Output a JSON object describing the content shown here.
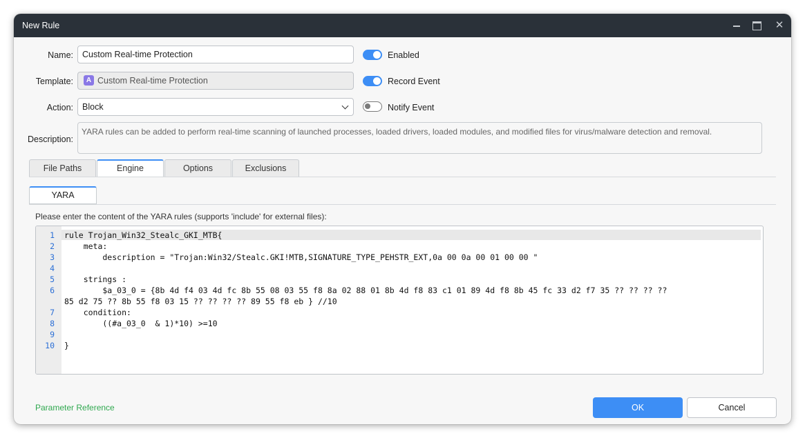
{
  "window": {
    "title": "New Rule"
  },
  "form": {
    "name_label": "Name:",
    "name_value": "Custom Real-time Protection",
    "template_label": "Template:",
    "template_badge": "A",
    "template_value": "Custom Real-time Protection",
    "action_label": "Action:",
    "action_value": "Block",
    "description_label": "Description:",
    "description_value": "YARA rules can be added to perform real-time scanning of launched processes, loaded drivers, loaded modules, and modified files for virus/malware detection and removal."
  },
  "toggles": {
    "enabled": {
      "label": "Enabled",
      "on": true
    },
    "record_event": {
      "label": "Record Event",
      "on": true
    },
    "notify_event": {
      "label": "Notify Event",
      "on": false
    }
  },
  "tabs": [
    "File Paths",
    "Engine",
    "Options",
    "Exclusions"
  ],
  "active_tab": "Engine",
  "subtab": "YARA",
  "hint": "Please enter the content of the YARA rules (supports 'include' for external files):",
  "editor": {
    "line_numbers": [
      "1",
      "2",
      "3",
      "4",
      "5",
      "6",
      "",
      "7",
      "8",
      "9",
      "10"
    ],
    "lines": [
      "rule Trojan_Win32_Stealc_GKI_MTB{",
      "    meta:",
      "        description = \"Trojan:Win32/Stealc.GKI!MTB,SIGNATURE_TYPE_PEHSTR_EXT,0a 00 0a 00 01 00 00 \"",
      "",
      "    strings :",
      "        $a_03_0 = {8b 4d f4 03 4d fc 8b 55 08 03 55 f8 8a 02 88 01 8b 4d f8 83 c1 01 89 4d f8 8b 45 fc 33 d2 f7 35 ?? ?? ?? ??",
      "85 d2 75 ?? 8b 55 f8 03 15 ?? ?? ?? ?? 89 55 f8 eb } //10",
      "    condition:",
      "        ((#a_03_0  & 1)*10) >=10",
      "",
      "}"
    ]
  },
  "footer": {
    "param_ref": "Parameter Reference",
    "ok": "OK",
    "cancel": "Cancel"
  },
  "colors": {
    "accent": "#3d8ef5",
    "titlebar": "#2a3139",
    "link": "#2fa84f"
  }
}
